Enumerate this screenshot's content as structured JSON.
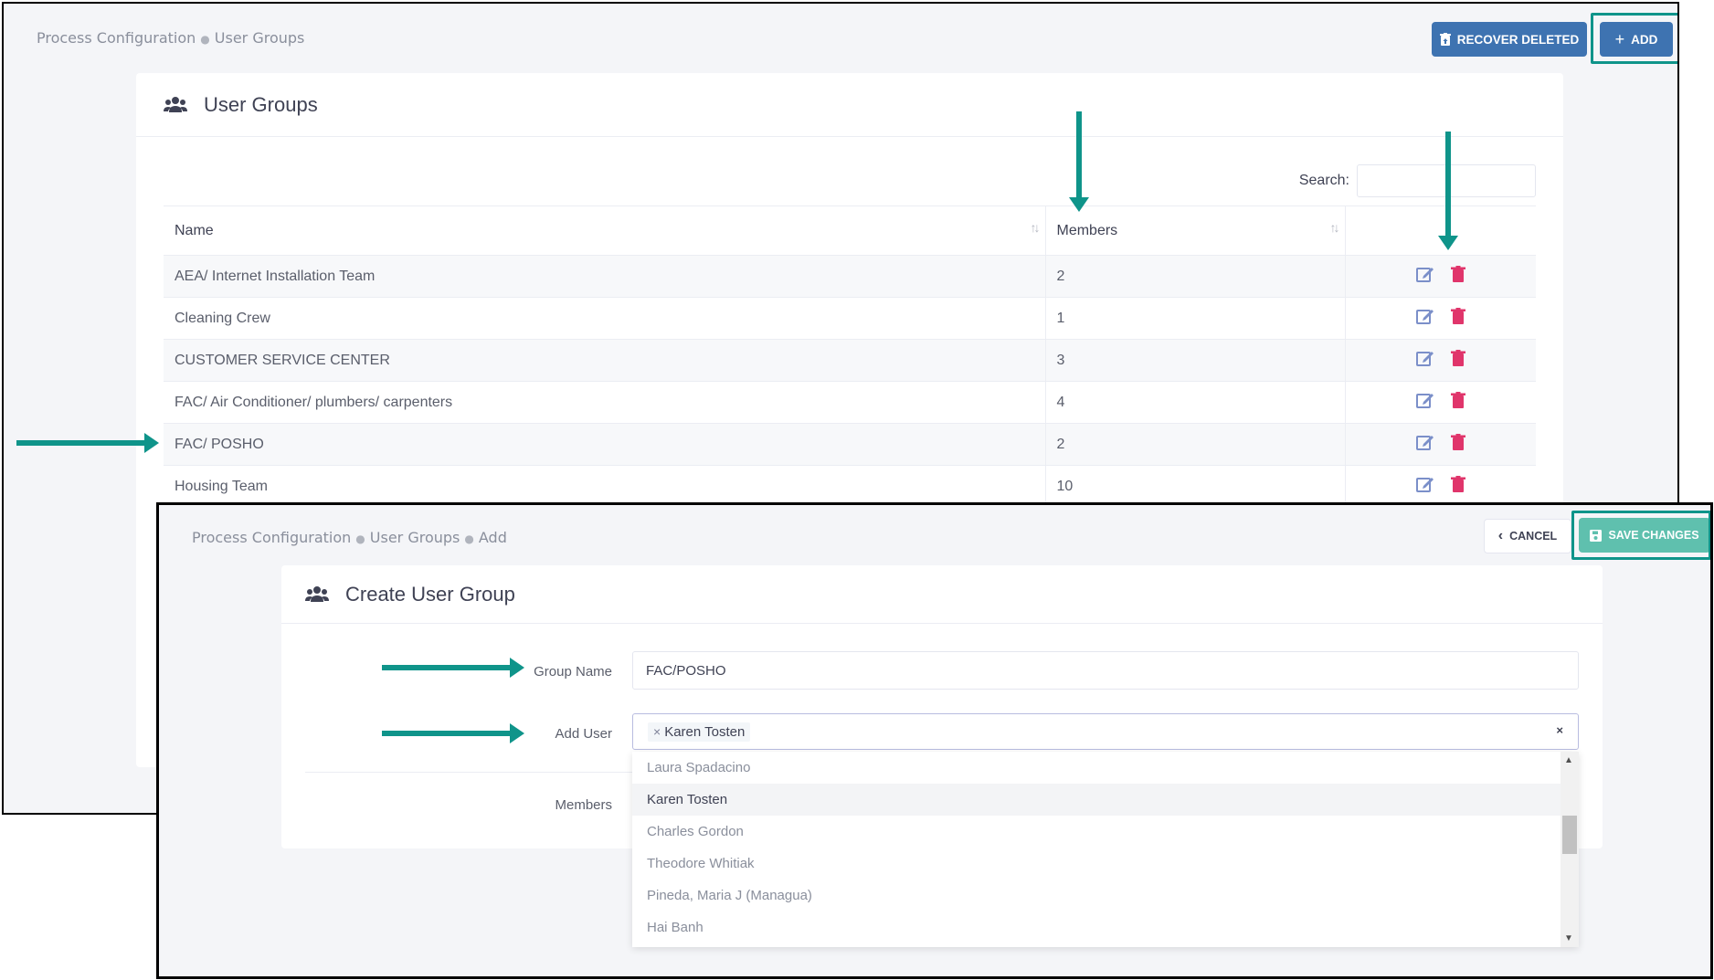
{
  "back": {
    "breadcrumb": [
      "Process Configuration",
      "User Groups"
    ],
    "buttons": {
      "recover": "RECOVER DELETED",
      "add": "ADD"
    },
    "title": "User Groups",
    "search_label": "Search:",
    "columns": {
      "name": "Name",
      "members": "Members"
    },
    "rows": [
      {
        "name": "AEA/ Internet Installation Team",
        "members": "2"
      },
      {
        "name": "Cleaning Crew",
        "members": "1"
      },
      {
        "name": "CUSTOMER SERVICE CENTER",
        "members": "3"
      },
      {
        "name": "FAC/ Air Conditioner/ plumbers/ carpenters",
        "members": "4"
      },
      {
        "name": "FAC/ POSHO",
        "members": "2"
      },
      {
        "name": "Housing Team",
        "members": "10"
      }
    ]
  },
  "front": {
    "breadcrumb": [
      "Process Configuration",
      "User Groups",
      "Add"
    ],
    "buttons": {
      "cancel": "CANCEL",
      "save": "SAVE CHANGES"
    },
    "title": "Create User Group",
    "labels": {
      "group_name": "Group Name",
      "add_user": "Add User",
      "members": "Members"
    },
    "group_name_value": "FAC/POSHO",
    "selected_user": "Karen Tosten",
    "dropdown_options": [
      "Laura Spadacino",
      "Karen Tosten",
      "Charles Gordon",
      "Theodore Whitiak",
      "Pineda, Maria J (Managua)",
      "Hai Banh"
    ]
  },
  "colors": {
    "accent_teal": "#0f948a",
    "primary_button": "#3e73b1",
    "save_button": "#5fc0ae",
    "delete_icon": "#e0356b",
    "edit_icon": "#7b8fc9"
  }
}
